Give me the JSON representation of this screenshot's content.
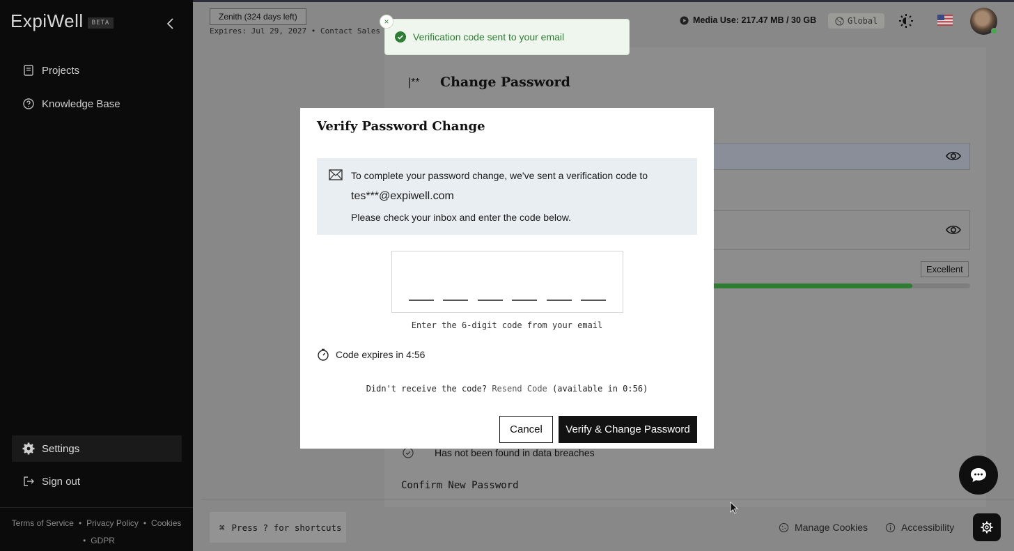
{
  "sidebar": {
    "logo": "ExpiWell",
    "beta": "BETA",
    "items": [
      {
        "label": "Projects",
        "icon": "document-icon"
      },
      {
        "label": "Knowledge Base",
        "icon": "question-circle-icon"
      }
    ],
    "settings_label": "Settings",
    "signout_label": "Sign out",
    "footer": {
      "terms": "Terms of Service",
      "privacy": "Privacy Policy",
      "cookies": "Cookies",
      "gdpr": "GDPR"
    }
  },
  "header": {
    "plan": "Zenith (324 days left)",
    "expires": "Expires: Jul 29, 2027",
    "contact": "Contact Sales",
    "media_use": "Media Use: 217.47 MB / 30 GB",
    "region": "Global"
  },
  "toast": {
    "message": "Verification code sent to your email",
    "close": "×"
  },
  "page": {
    "title": "Change Password",
    "title_icon": "|**",
    "strength_label": "Excellent",
    "strength_percent": 78,
    "breach_text": "Has not been found in data breaches",
    "confirm_label": "Confirm New Password"
  },
  "modal": {
    "title": "Verify Password Change",
    "info_line1": "To complete your password change, we've sent a verification code to",
    "email": "tes***@expiwell.com",
    "info_line3": "Please check your inbox and enter the code below.",
    "code_hint": "Enter the 6-digit code from your email",
    "timer": "Code expires in 4:56",
    "resend_prefix": "Didn't receive the code?",
    "resend_link": "Resend Code",
    "resend_suffix": "(available in 0:56)",
    "cancel": "Cancel",
    "verify": "Verify & Change Password"
  },
  "footer": {
    "shortcut": "Press ? for shortcuts",
    "manage_cookies": "Manage Cookies",
    "accessibility": "Accessibility"
  },
  "colors": {
    "accent": "#121212",
    "success": "#2e7d32",
    "toast_bg": "#eef6ee",
    "info_bg": "#e9eef3"
  }
}
